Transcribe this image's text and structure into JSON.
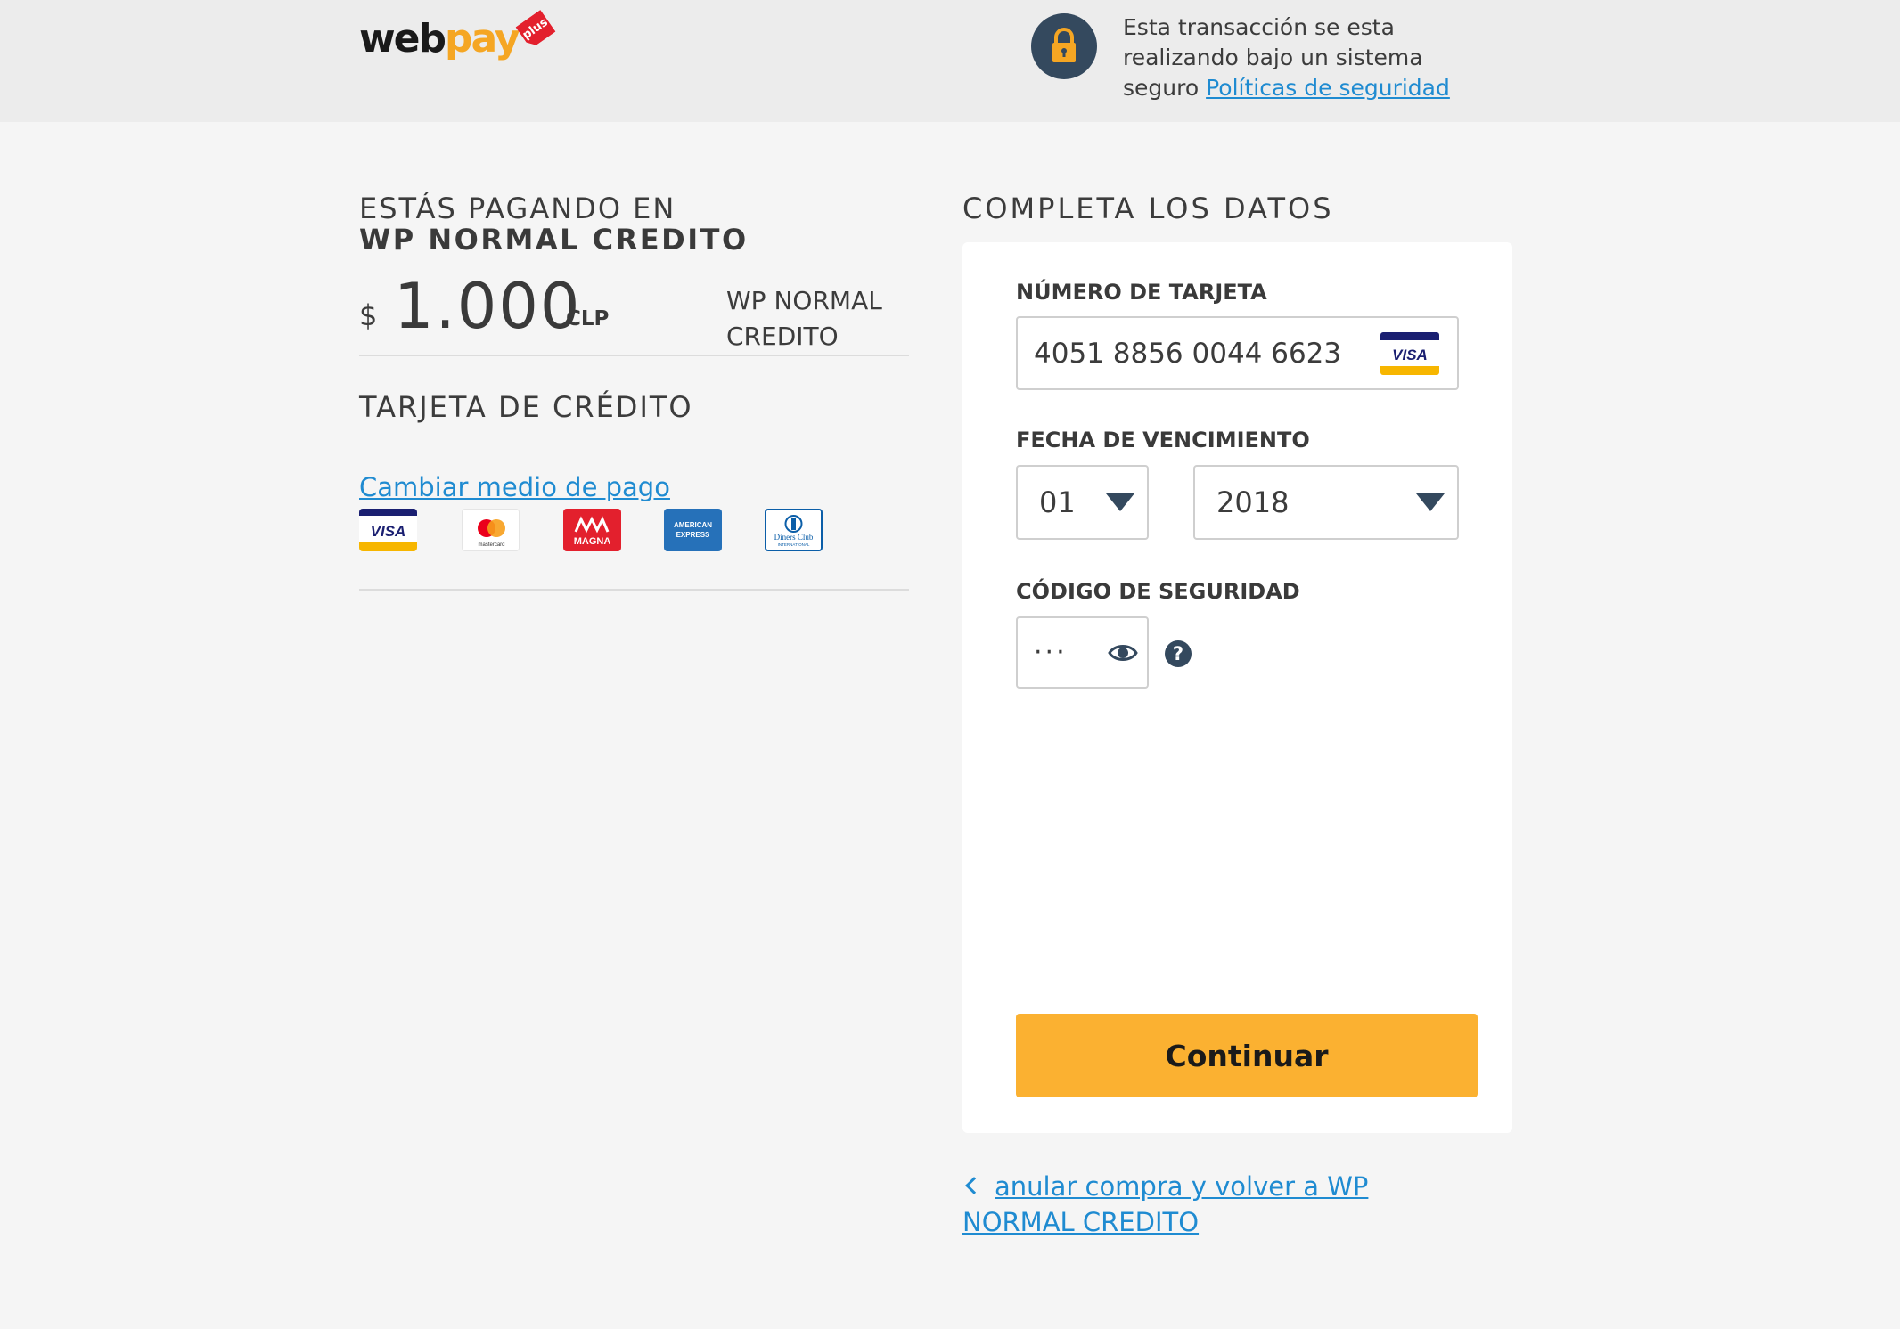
{
  "header": {
    "logo": {
      "web": "web",
      "pay": "pay",
      "plus": "plus"
    },
    "security_text": "Esta transacción se esta realizando bajo un sistema seguro",
    "security_link": "Políticas de seguridad"
  },
  "summary": {
    "paying_label": "ESTÁS PAGANDO EN",
    "merchant_name": "WP NORMAL CREDITO",
    "currency_symbol": "$",
    "amount": "1.000",
    "currency_code": "CLP",
    "merchant_side": "WP NORMAL CREDITO",
    "payment_type": "TARJETA DE CRÉDITO",
    "change_method": "Cambiar medio de pago",
    "brands": [
      {
        "name": "visa",
        "label": "VISA",
        "color": "#1a1f71"
      },
      {
        "name": "mastercard",
        "label": "mastercard",
        "color": "#eb001b"
      },
      {
        "name": "magna",
        "label": "MAGNA",
        "color": "#e3202d"
      },
      {
        "name": "american-express",
        "label": "AMERICAN EXPRESS",
        "color": "#2671b9"
      },
      {
        "name": "diners-club",
        "label": "Diners Club INTERNATIONAL",
        "color": "#0b5ea8"
      }
    ]
  },
  "form": {
    "title": "COMPLETA LOS DATOS",
    "card_number_label": "NÚMERO DE TARJETA",
    "card_number_value": "4051 8856 0044 6623",
    "card_brand_label": "VISA",
    "expiry_label": "FECHA DE VENCIMIENTO",
    "expiry_month": "01",
    "expiry_year": "2018",
    "cvv_label": "CÓDIGO DE SEGURIDAD",
    "cvv_value": "···",
    "help": "?",
    "continue_label": "Continuar"
  },
  "footer": {
    "cancel_link": "anular compra y volver a WP NORMAL CREDITO"
  },
  "colors": {
    "accent": "#fbb131",
    "link": "#1f8bd1",
    "dark": "#34495e",
    "header_bg": "#ececec",
    "page_bg": "#f5f5f5"
  }
}
